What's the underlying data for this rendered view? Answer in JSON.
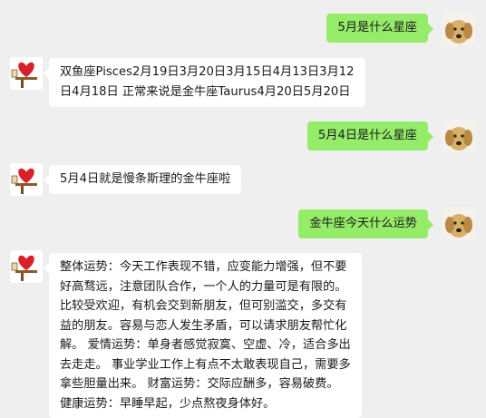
{
  "colors": {
    "background": "#efefef",
    "outgoing_bubble": "#95ec69",
    "incoming_bubble": "#ffffff"
  },
  "avatars": {
    "me": "dog-avatar",
    "bot": "red-heart-mailbox-avatar"
  },
  "messages": [
    {
      "from": "me",
      "text": "5月是什么星座"
    },
    {
      "from": "bot",
      "text": "双鱼座Pisces2月19日3月20日3月15日4月13日3月12\n日4月18日 正常来说是金牛座Taurus4月20日5月20日"
    },
    {
      "from": "me",
      "text": "5月4日是什么星座"
    },
    {
      "from": "bot",
      "text": "5月4日就是慢条斯理的金牛座啦"
    },
    {
      "from": "me",
      "text": "金牛座今天什么运势"
    },
    {
      "from": "bot",
      "text": "整体运势：今天工作表现不错，应变能力增强，但不要\n好高骛远，注意团队合作，一个人的力量可是有限的。\n比较受欢迎，有机会交到新朋友，但可别滥交，多交有\n益的朋友。容易与恋人发生矛盾，可以请求朋友帮忙化\n解。 爱情运势：单身者感觉寂寞、空虚、冷，适合多出\n去走走。 事业学业工作上有点不太敢表现自己，需要多\n拿些胆量出来。 财富运势：交际应酬多，容易破费。\n健康运势：早睡早起，少点熬夜身体好。"
    }
  ]
}
